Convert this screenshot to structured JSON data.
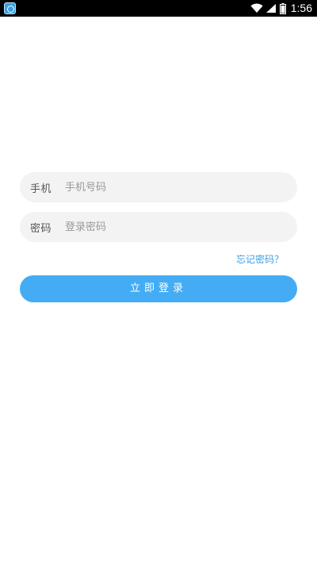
{
  "status_bar": {
    "time": "1:56",
    "icons": [
      "app-icon",
      "wifi-icon",
      "signal-icon",
      "battery-icon"
    ]
  },
  "login_form": {
    "phone": {
      "label": "手机",
      "placeholder": "手机号码",
      "value": ""
    },
    "password": {
      "label": "密码",
      "placeholder": "登录密码",
      "value": ""
    },
    "forgot_password": "忘记密码？",
    "submit_label": "立即登录"
  },
  "colors": {
    "accent": "#44acf4",
    "link": "#3a9fe0",
    "field_background": "#f3f3f3",
    "status_bar": "#000000"
  }
}
